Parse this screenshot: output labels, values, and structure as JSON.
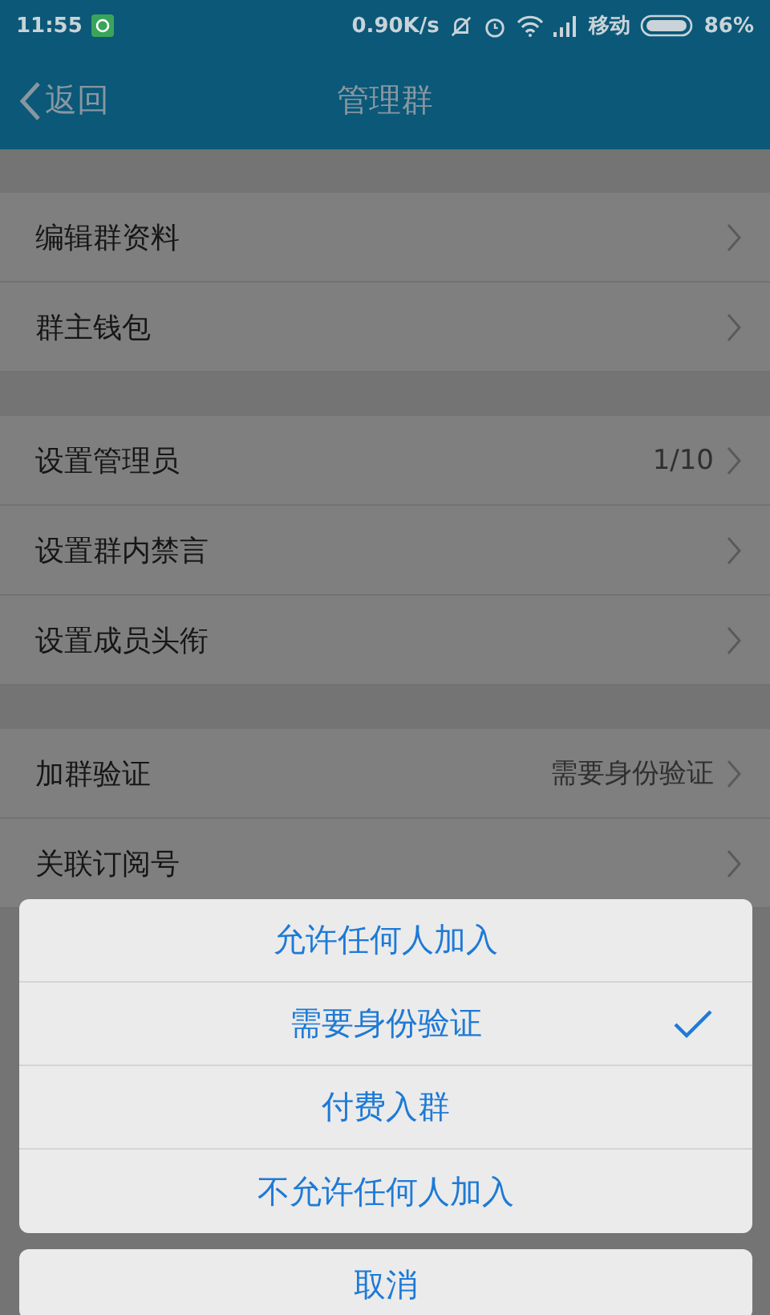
{
  "status_bar": {
    "time": "11:55",
    "speed": "0.90K/s",
    "carrier": "移动",
    "battery": "86%"
  },
  "header": {
    "back": "返回",
    "title": "管理群"
  },
  "sections": [
    {
      "rows": [
        {
          "label": "编辑群资料"
        },
        {
          "label": "群主钱包"
        }
      ]
    },
    {
      "rows": [
        {
          "label": "设置管理员",
          "value": "1/10"
        },
        {
          "label": "设置群内禁言"
        },
        {
          "label": "设置成员头衔"
        }
      ]
    },
    {
      "rows": [
        {
          "label": "加群验证",
          "value": "需要身份验证"
        },
        {
          "label": "关联订阅号"
        }
      ]
    }
  ],
  "sheet": {
    "options": [
      {
        "label": "允许任何人加入",
        "selected": false
      },
      {
        "label": "需要身份验证",
        "selected": true
      },
      {
        "label": "付费入群",
        "selected": false
      },
      {
        "label": "不允许任何人加入",
        "selected": false
      }
    ],
    "cancel": "取消"
  }
}
